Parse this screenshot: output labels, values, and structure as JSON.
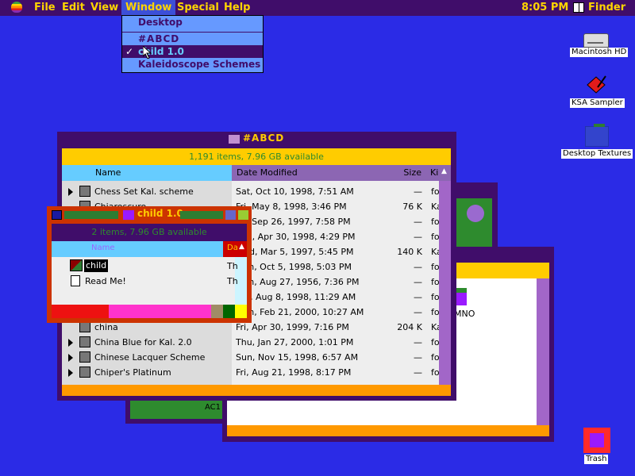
{
  "menubar": {
    "items": [
      "File",
      "Edit",
      "View",
      "Window",
      "Special",
      "Help"
    ],
    "clock": "8:05 PM",
    "app": "Finder"
  },
  "window_menu": {
    "items": [
      {
        "label": "Desktop",
        "checked": false,
        "selected": false
      },
      {
        "label": "#ABCD",
        "checked": false,
        "selected": false
      },
      {
        "label": "child 1.0",
        "checked": true,
        "selected": true
      },
      {
        "label": "Kaleidoscope Schemes",
        "checked": false,
        "selected": false
      }
    ],
    "check_mark": "✓"
  },
  "desktop_icons": [
    {
      "label": "Macintosh HD",
      "icon": "hard-drive-icon"
    },
    {
      "label": "KSA Sampler",
      "icon": "ksa-sampler-icon"
    },
    {
      "label": "Desktop Textures",
      "icon": "folder-icon"
    },
    {
      "label": "Trash",
      "icon": "trash-icon"
    }
  ],
  "abcd_window": {
    "title": "#ABCD",
    "status": "1,191 items, 7.96 GB available",
    "columns": {
      "name": "Name",
      "date": "Date Modified",
      "size": "Size",
      "kind": "Ki"
    },
    "rows": [
      {
        "name": "Chess Set Kal. scheme",
        "date": "Sat, Oct 10, 1998, 7:51 AM",
        "size": "—",
        "kind": "fol",
        "expandable": true
      },
      {
        "name": "Chiaroscuro",
        "date": "Fri, May 8, 1998, 3:46 PM",
        "size": "76 K",
        "kind": "Ka",
        "expandable": false
      },
      {
        "name": "",
        "date": "Fri, Sep 26, 1997, 7:58 PM",
        "size": "—",
        "kind": "fol",
        "expandable": false
      },
      {
        "name": "",
        "date": "Thu, Apr 30, 1998, 4:29 PM",
        "size": "—",
        "kind": "fol",
        "expandable": false
      },
      {
        "name": "",
        "date": "Wed, Mar 5, 1997, 5:45 PM",
        "size": "140 K",
        "kind": "Ka",
        "expandable": false
      },
      {
        "name": "",
        "date": "Mon, Oct 5, 1998, 5:03 PM",
        "size": "—",
        "kind": "fol",
        "expandable": false
      },
      {
        "name": "",
        "date": "Mon, Aug 27, 1956, 7:36 PM",
        "size": "—",
        "kind": "fol",
        "expandable": false
      },
      {
        "name": "",
        "date": "Sat, Aug 8, 1998, 11:29 AM",
        "size": "—",
        "kind": "fol",
        "expandable": false
      },
      {
        "name": "",
        "date": "Mon, Feb 21, 2000, 10:27 AM",
        "size": "—",
        "kind": "fol",
        "expandable": false
      },
      {
        "name": "china",
        "date": "Fri, Apr 30, 1999, 7:16 PM",
        "size": "204 K",
        "kind": "Ka",
        "expandable": false
      },
      {
        "name": "China Blue for Kal. 2.0",
        "date": "Thu, Jan 27, 2000, 1:01 PM",
        "size": "—",
        "kind": "fol",
        "expandable": true
      },
      {
        "name": "Chinese Lacquer Scheme",
        "date": "Sun, Nov 15, 1998, 6:57 AM",
        "size": "—",
        "kind": "fol",
        "expandable": true
      },
      {
        "name": "Chiper's Platinum",
        "date": "Fri, Aug 21, 1998, 8:17 PM",
        "size": "—",
        "kind": "fol",
        "expandable": true
      }
    ]
  },
  "child_window": {
    "title": "child 1.0",
    "status": "2 items, 7.96 GB available",
    "columns": {
      "name": "Name",
      "date": "Da"
    },
    "rows": [
      {
        "name": "child",
        "date": "Th"
      },
      {
        "name": "Read Me!",
        "date": "Th"
      }
    ]
  },
  "back_window": {
    "partial_text": "MNO"
  },
  "green_window": {
    "partial_text": "AC1"
  },
  "colors": {
    "desktop": "#2b2be6",
    "menubar_bg": "#400d6a",
    "menubar_text": "#ffd500",
    "window_frame": "#400d6a",
    "status_bar": "#ffcc00",
    "header_light": "#66ccff",
    "header_purple": "#8c66b3",
    "child_frame": "#cc3300",
    "selection": "#400d6a"
  }
}
